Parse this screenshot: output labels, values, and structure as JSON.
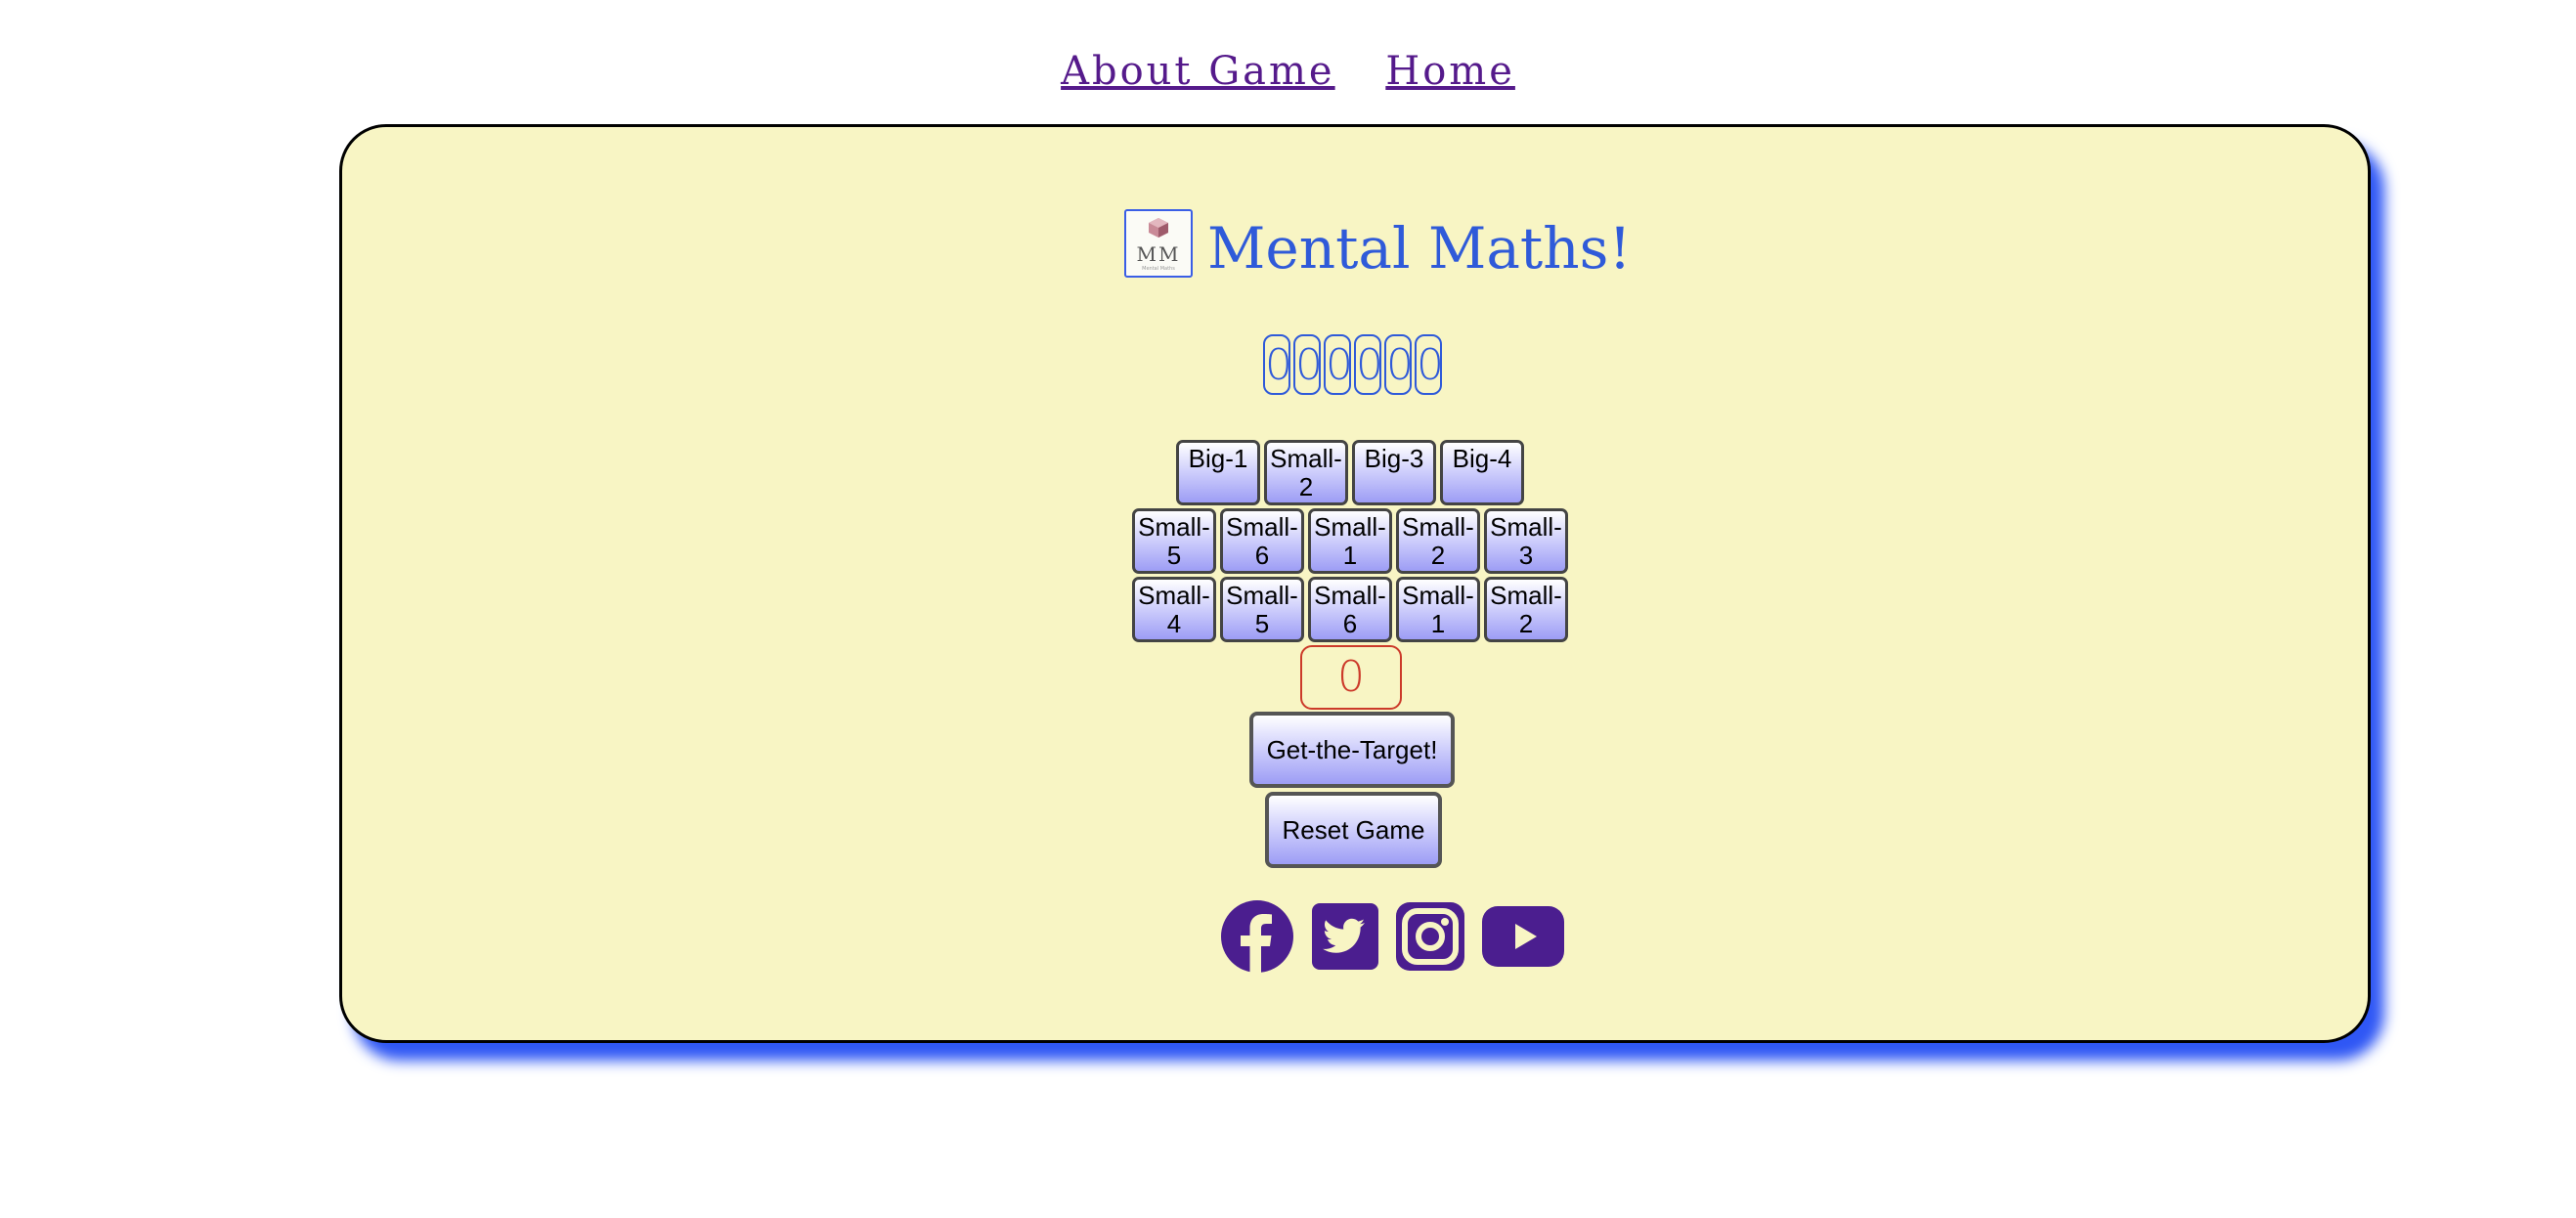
{
  "nav": {
    "about": "About Game",
    "home": "Home"
  },
  "header": {
    "logo_text": "MM",
    "logo_subtext": "Mental Maths",
    "title": "Mental Maths!"
  },
  "target_digits": [
    "0",
    "0",
    "0",
    "0",
    "0",
    "0"
  ],
  "cards": {
    "row1": [
      "Big-1",
      "Small-2",
      "Big-3",
      "Big-4"
    ],
    "row2": [
      "Small-5",
      "Small-6",
      "Small-1",
      "Small-2",
      "Small-3"
    ],
    "row3": [
      "Small-4",
      "Small-5",
      "Small-6",
      "Small-1",
      "Small-2"
    ]
  },
  "result_value": "0",
  "buttons": {
    "get_target": "Get-the-Target!",
    "reset": "Reset Game"
  },
  "social": [
    "facebook-icon",
    "twitter-icon",
    "instagram-icon",
    "youtube-icon"
  ],
  "colors": {
    "card_bg": "#f8f5c4",
    "accent_blue": "#2f5ad9",
    "shadow_blue": "#2f57f5",
    "result_red": "#cc3a2a",
    "social_purple": "#4b1e8f"
  }
}
